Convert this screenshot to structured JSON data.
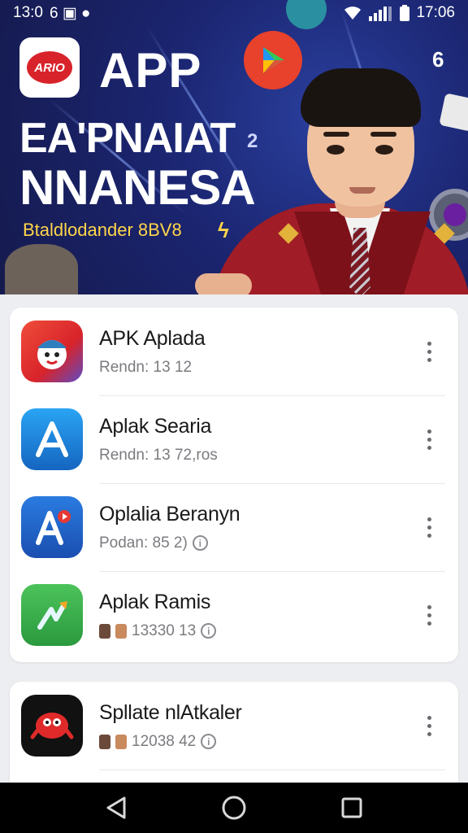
{
  "status_bar": {
    "time_left": "13:0",
    "left_glyphs": "6 ▣ ●",
    "time_right": "17:06"
  },
  "banner": {
    "logo_text": "ARIO",
    "title_app": "APP",
    "line1": "EA'PNAIAT",
    "line2": "NNANESA",
    "subtitle": "Btaldlodander 8BV8"
  },
  "apps": [
    {
      "title": "APK Aplada",
      "subtitle": "Rendn: 13 12",
      "icon": "cartoon-face-icon",
      "icon_bg": "#e83a32",
      "show_info": false,
      "show_avatars": false
    },
    {
      "title": "Aplak Searia",
      "subtitle": "Rendn: 13 72,ros",
      "icon": "app-store-a-icon",
      "icon_bg": "#1e88e5",
      "show_info": false,
      "show_avatars": false
    },
    {
      "title": "Oplalia Beranyn",
      "subtitle": "Podan: 85 2)",
      "icon": "app-store-a-badge-icon",
      "icon_bg": "#1f62c9",
      "show_info": true,
      "show_avatars": false
    },
    {
      "title": "Aplak Ramis",
      "subtitle": "13330 13",
      "icon": "green-arrow-icon",
      "icon_bg": "#3fb04b",
      "show_info": true,
      "show_avatars": true
    }
  ],
  "apps_2": [
    {
      "title": "Spllate nlAtkaler",
      "subtitle": "12038 42",
      "icon": "red-mascot-icon",
      "icon_bg": "#111111",
      "show_info": true,
      "show_avatars": true
    }
  ]
}
